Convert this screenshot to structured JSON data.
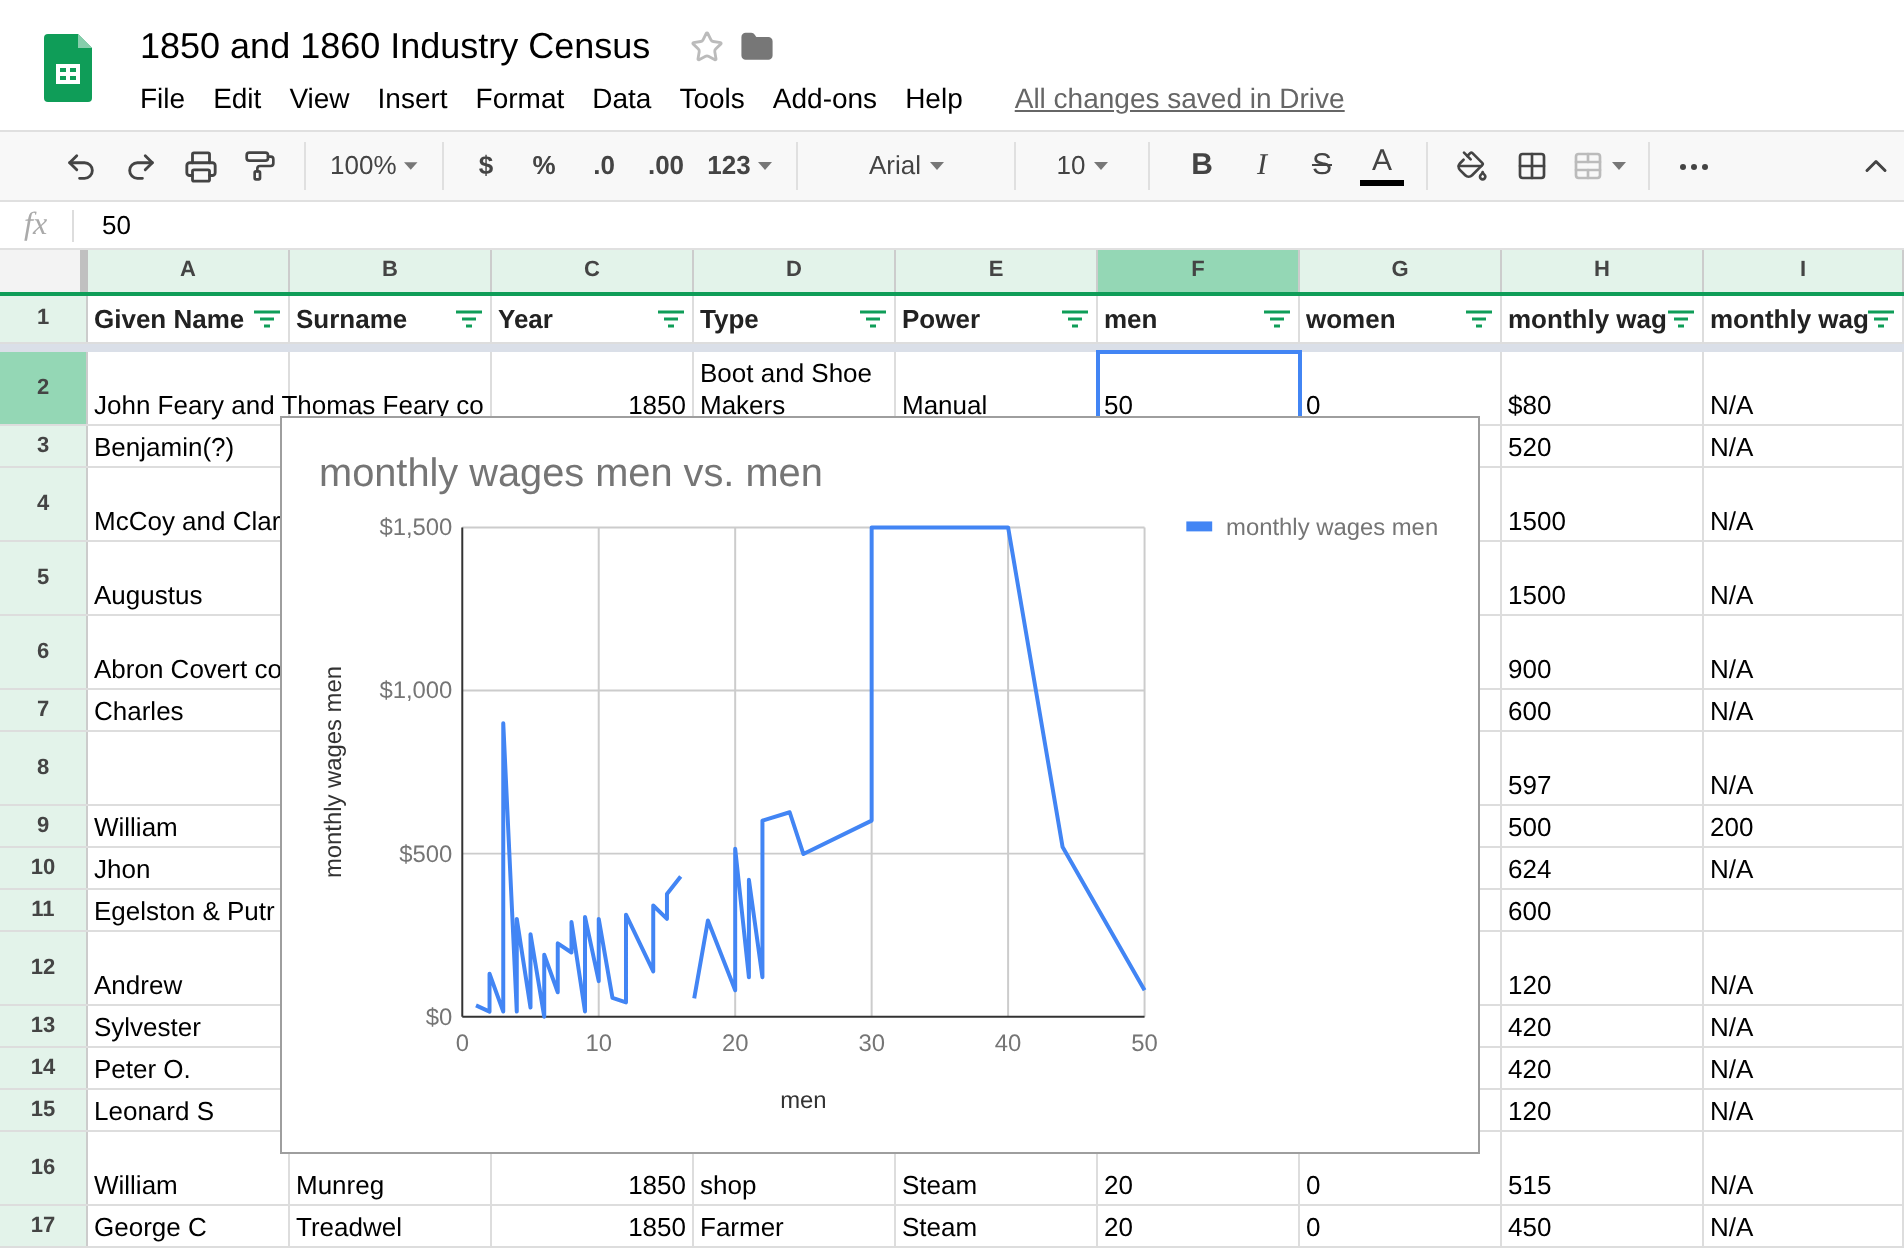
{
  "document": {
    "title": "1850 and 1860 Industry Census",
    "save_status": "All changes saved in Drive"
  },
  "menu": [
    "File",
    "Edit",
    "View",
    "Insert",
    "Format",
    "Data",
    "Tools",
    "Add-ons",
    "Help"
  ],
  "toolbar": {
    "zoom": "100%",
    "currency": "$",
    "percent": "%",
    "decrease_decimals": ".0",
    "increase_decimals": ".00",
    "number_format": "123",
    "font": "Arial",
    "font_size": "10",
    "bold": "B",
    "italic": "I",
    "strikethrough": "S",
    "text_color": "A"
  },
  "formula_bar": {
    "label": "fx",
    "value": "50"
  },
  "columns": [
    {
      "letter": "A",
      "selected": false
    },
    {
      "letter": "B",
      "selected": false
    },
    {
      "letter": "C",
      "selected": false
    },
    {
      "letter": "D",
      "selected": false
    },
    {
      "letter": "E",
      "selected": false
    },
    {
      "letter": "F",
      "selected": true
    },
    {
      "letter": "G",
      "selected": false
    },
    {
      "letter": "H",
      "selected": false
    },
    {
      "letter": "I",
      "selected": false
    }
  ],
  "header_row": {
    "number": "1",
    "cells": [
      "Given Name",
      "Surname",
      "Year",
      "Type",
      "Power",
      "men",
      "women",
      "monthly wag",
      "monthly wag"
    ]
  },
  "rows": [
    {
      "number": "2",
      "kind": "tall",
      "selected": true,
      "cells": [
        "John Feary and Thomas Feary co",
        null,
        "1850",
        "Boot and Shoe Makers",
        "Manual",
        "50",
        "0",
        "$80",
        "N/A"
      ]
    },
    {
      "number": "3",
      "kind": "normal",
      "selected": false,
      "cells": [
        "Benjamin(?)",
        null,
        null,
        null,
        null,
        null,
        null,
        "520",
        "N/A"
      ]
    },
    {
      "number": "4",
      "kind": "tall",
      "selected": false,
      "cells": [
        "McCoy and Clar",
        null,
        null,
        null,
        null,
        null,
        null,
        "1500",
        "N/A"
      ]
    },
    {
      "number": "5",
      "kind": "tall",
      "selected": false,
      "cells": [
        "Augustus",
        null,
        null,
        null,
        null,
        null,
        null,
        "1500",
        "N/A"
      ]
    },
    {
      "number": "6",
      "kind": "tall",
      "selected": false,
      "cells": [
        "Abron Covert co",
        null,
        null,
        null,
        null,
        null,
        null,
        "900",
        "N/A"
      ]
    },
    {
      "number": "7",
      "kind": "normal",
      "selected": false,
      "cells": [
        "Charles",
        null,
        null,
        null,
        null,
        null,
        null,
        "600",
        "N/A"
      ]
    },
    {
      "number": "8",
      "kind": "tall",
      "selected": false,
      "cells": [
        null,
        null,
        null,
        null,
        null,
        null,
        null,
        "597",
        "N/A"
      ]
    },
    {
      "number": "9",
      "kind": "normal",
      "selected": false,
      "cells": [
        "William",
        null,
        null,
        null,
        null,
        null,
        null,
        "500",
        "200"
      ]
    },
    {
      "number": "10",
      "kind": "normal",
      "selected": false,
      "cells": [
        "Jhon",
        null,
        null,
        null,
        null,
        null,
        null,
        "624",
        "N/A"
      ]
    },
    {
      "number": "11",
      "kind": "normal",
      "selected": false,
      "cells": [
        "Egelston & Putr",
        null,
        null,
        null,
        null,
        null,
        null,
        "600",
        null
      ]
    },
    {
      "number": "12",
      "kind": "tall",
      "selected": false,
      "cells": [
        "Andrew",
        null,
        null,
        null,
        null,
        null,
        null,
        "120",
        "N/A"
      ]
    },
    {
      "number": "13",
      "kind": "normal",
      "selected": false,
      "cells": [
        "Sylvester",
        null,
        null,
        null,
        null,
        null,
        null,
        "420",
        "N/A"
      ]
    },
    {
      "number": "14",
      "kind": "normal",
      "selected": false,
      "cells": [
        "Peter O.",
        null,
        null,
        null,
        null,
        null,
        null,
        "420",
        "N/A"
      ]
    },
    {
      "number": "15",
      "kind": "normal",
      "selected": false,
      "cells": [
        "Leonard S",
        null,
        null,
        null,
        null,
        null,
        null,
        "120",
        "N/A"
      ]
    },
    {
      "number": "16",
      "kind": "tall",
      "selected": false,
      "cells": [
        "William",
        "Munreg",
        "1850",
        "shop",
        "Steam",
        "20",
        "0",
        "515",
        "N/A"
      ]
    },
    {
      "number": "17",
      "kind": "normal",
      "selected": false,
      "cells": [
        "George C",
        "Treadwel",
        "1850",
        "Farmer",
        "Steam",
        "20",
        "0",
        "450",
        "N/A"
      ]
    }
  ],
  "chart": {
    "chart_data": {
      "type": "line",
      "title": "monthly wages men vs. men",
      "xlabel": "men",
      "ylabel": "monthly wages men",
      "x": [
        1,
        2,
        2,
        3,
        3,
        4,
        4,
        5,
        5,
        6,
        6,
        7,
        7,
        8,
        8,
        9,
        9,
        10,
        10,
        11,
        12,
        12,
        14,
        14,
        15,
        15,
        16,
        16.5,
        17,
        18,
        20,
        20,
        21,
        21,
        22,
        22,
        24,
        25,
        30,
        30,
        40,
        44,
        50
      ],
      "series": [
        {
          "name": "monthly wages men",
          "color": "#4285f4",
          "values": [
            35,
            16,
            132,
            16,
            900,
            16,
            300,
            28,
            253,
            0,
            190,
            75,
            225,
            197,
            290,
            16,
            306,
            109,
            300,
            58,
            44,
            313,
            139,
            341,
            300,
            376,
            430,
            null,
            56,
            295,
            81,
            515,
            121,
            420,
            121,
            601,
            627,
            499,
            601,
            1500,
            1500,
            520,
            81
          ]
        }
      ],
      "grid": true,
      "xlim": [
        0,
        50
      ],
      "ylim": [
        0,
        1500
      ],
      "xticks": [
        0,
        10,
        20,
        30,
        40,
        50
      ],
      "yticks": [
        {
          "value": 0,
          "label": "$0"
        },
        {
          "value": 500,
          "label": "$500"
        },
        {
          "value": 1000,
          "label": "$1,000"
        },
        {
          "value": 1500,
          "label": "$1,500"
        }
      ]
    }
  }
}
